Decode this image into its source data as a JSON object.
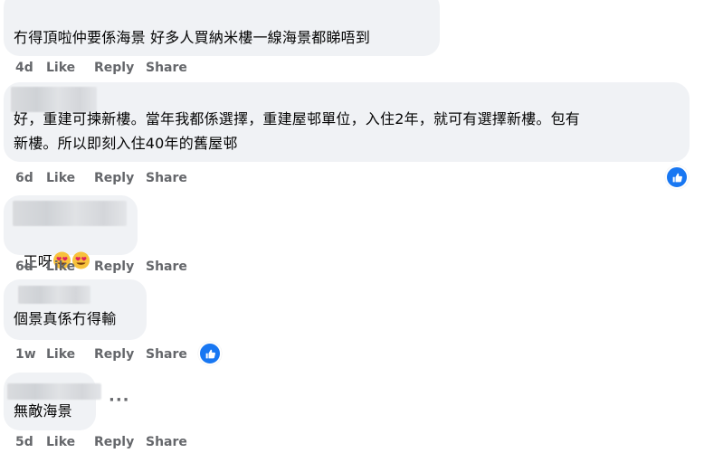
{
  "actions": {
    "like": "Like",
    "reply": "Reply",
    "share": "Share"
  },
  "comments": [
    {
      "text": "冇得頂啦仲要係海景 好多人買納米樓一線海景都睇唔到",
      "time": "4d",
      "reactions": null
    },
    {
      "text": "好，重建可揀新樓。當年我都係選擇，重建屋邨單位，入住2年，就可有選擇新樓。包有\n新樓。所以即刻入住40年的舊屋邨",
      "time": "6d",
      "reactions": "like-icon"
    },
    {
      "text": "正呀",
      "emojis": [
        "heart-eyes-emoji",
        "heart-eyes-emoji"
      ],
      "time": "6d",
      "reactions": null
    },
    {
      "text": "個景真係冇得輸",
      "time": "1w",
      "reactions": "like-icon"
    },
    {
      "text": "無敵海景",
      "time": "5d",
      "reactions": null,
      "more": "···"
    }
  ],
  "colors": {
    "bubble": "#f0f2f5",
    "meta": "#65676b",
    "like_blue": "#1877f2"
  }
}
